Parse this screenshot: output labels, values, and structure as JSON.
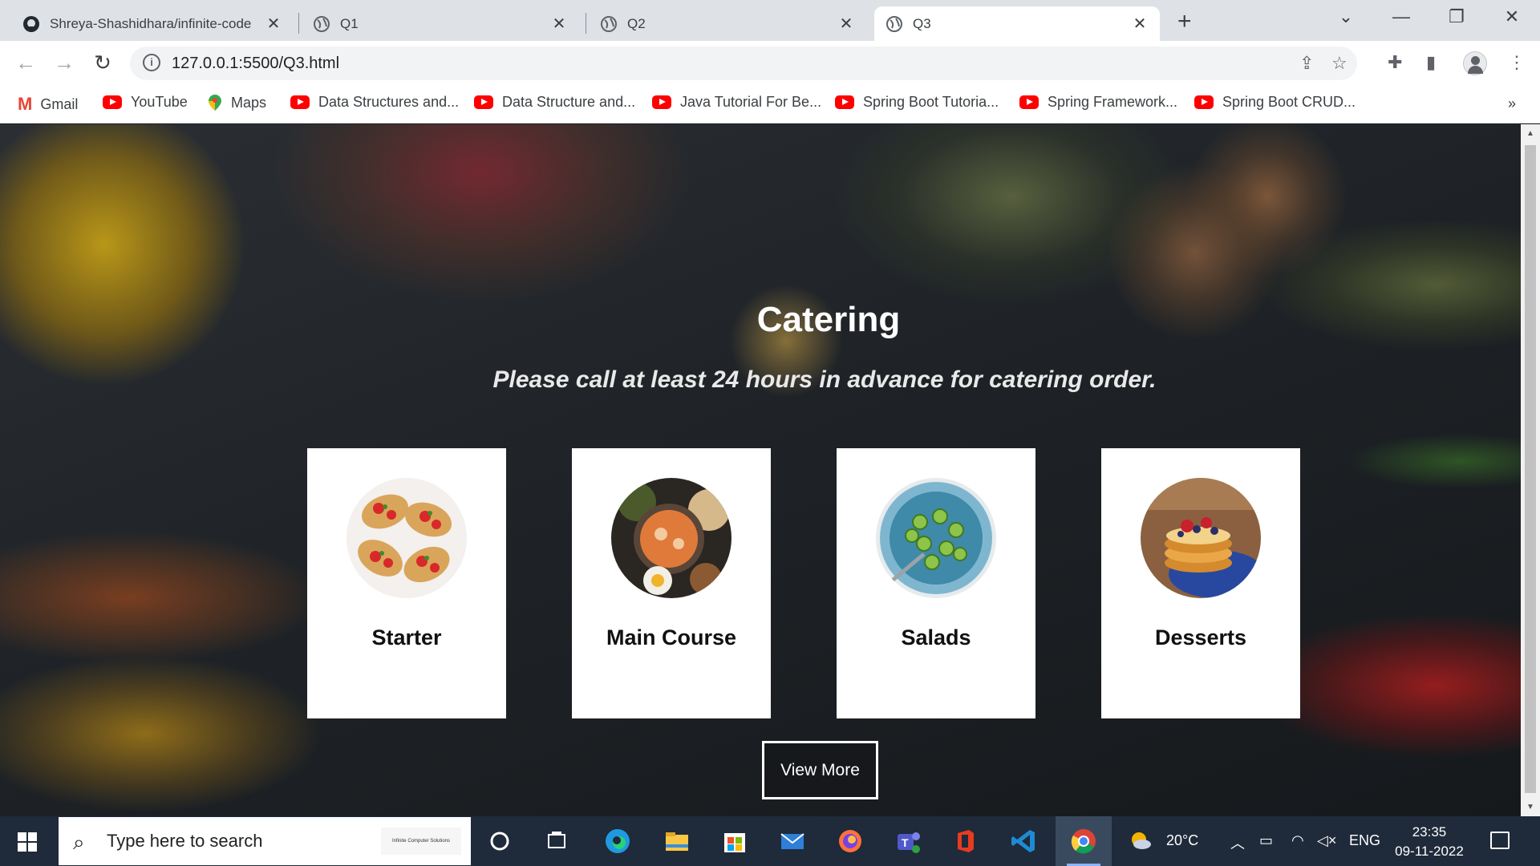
{
  "browser": {
    "tabs": [
      {
        "title": "Shreya-Shashidhara/infinite-code",
        "icon": "github-icon"
      },
      {
        "title": "Q1",
        "icon": "globe-icon"
      },
      {
        "title": "Q2",
        "icon": "globe-icon"
      },
      {
        "title": "Q3",
        "icon": "globe-icon",
        "active": true
      }
    ],
    "url": "127.0.0.1:5500/Q3.html",
    "bookmarks": [
      {
        "label": "Gmail",
        "icon": "gmail-icon"
      },
      {
        "label": "YouTube",
        "icon": "youtube-icon"
      },
      {
        "label": "Maps",
        "icon": "maps-icon"
      },
      {
        "label": "Data Structures and...",
        "icon": "youtube-icon"
      },
      {
        "label": "Data Structure and...",
        "icon": "youtube-icon"
      },
      {
        "label": "Java Tutorial For Be...",
        "icon": "youtube-icon"
      },
      {
        "label": "Spring Boot Tutoria...",
        "icon": "youtube-icon"
      },
      {
        "label": "Spring Framework...",
        "icon": "youtube-icon"
      },
      {
        "label": "Spring Boot CRUD...",
        "icon": "youtube-icon"
      }
    ],
    "bookmarks_more": "»"
  },
  "page": {
    "heading": "Catering",
    "subheading": "Please call at least 24 hours in advance for catering order.",
    "cards": [
      {
        "label": "Starter",
        "image": "bruschetta-photo"
      },
      {
        "label": "Main Course",
        "image": "curry-photo"
      },
      {
        "label": "Salads",
        "image": "cucumber-salad-photo"
      },
      {
        "label": "Desserts",
        "image": "pancakes-photo"
      }
    ],
    "view_more_label": "View More"
  },
  "taskbar": {
    "search_placeholder": "Type here to search",
    "search_logo_text": "Infinite Computer Solutions",
    "weather": "20°C",
    "language": "ENG",
    "time": "23:35",
    "date": "09-11-2022"
  },
  "colors": {
    "card_bg": "#ffffff",
    "heading": "#ffffff",
    "taskbar": "#1f2a3a",
    "youtube_red": "#ff0000"
  }
}
